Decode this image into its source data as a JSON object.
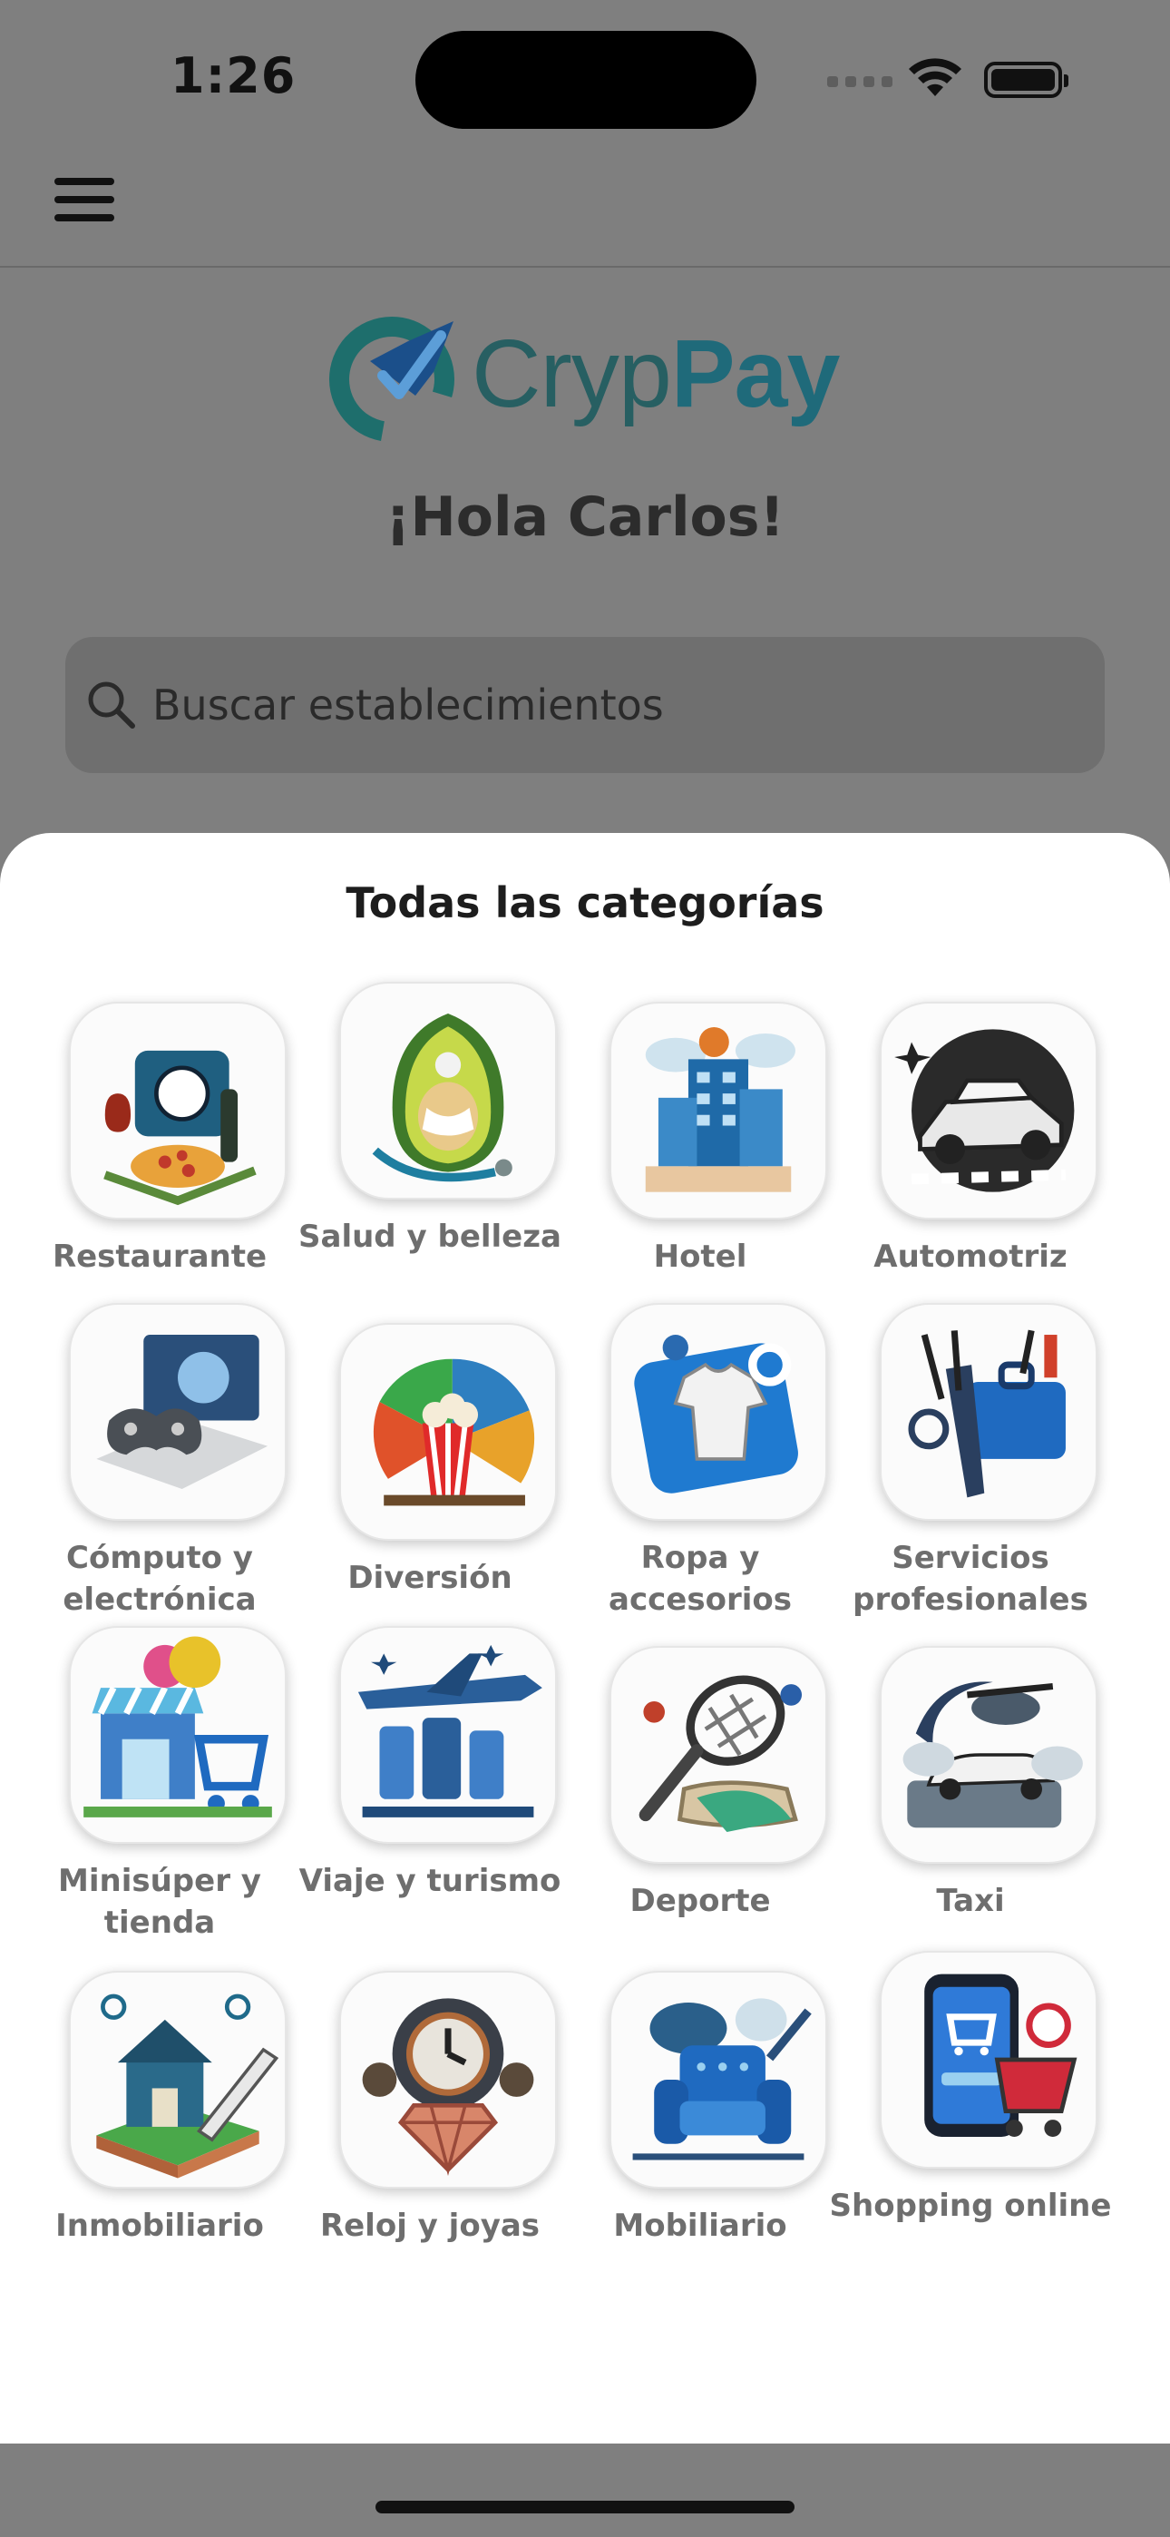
{
  "status_bar": {
    "time": "1:26"
  },
  "header": {
    "menu_icon": "hamburger-menu-icon"
  },
  "logo": {
    "text_light": "Cryp",
    "text_bold": "Pay"
  },
  "greeting": "¡Hola Carlos!",
  "search": {
    "placeholder": "Buscar establecimientos"
  },
  "sheet": {
    "title": "Todas las categorías",
    "categories": [
      {
        "label": "Restaurante",
        "icon": "restaurant-icon"
      },
      {
        "label": "Salud y belleza",
        "icon": "health-beauty-icon"
      },
      {
        "label": "Hotel",
        "icon": "hotel-icon"
      },
      {
        "label": "Automotriz",
        "icon": "car-icon"
      },
      {
        "label": "Cómputo y electrónica",
        "icon": "electronics-icon"
      },
      {
        "label": "Diversión",
        "icon": "entertainment-icon"
      },
      {
        "label": "Ropa y accesorios",
        "icon": "clothing-icon"
      },
      {
        "label": "Servicios profesionales",
        "icon": "briefcase-icon"
      },
      {
        "label": "Minisúper y tienda",
        "icon": "store-icon"
      },
      {
        "label": "Viaje y turismo",
        "icon": "travel-icon"
      },
      {
        "label": "Deporte",
        "icon": "sports-icon"
      },
      {
        "label": "Taxi",
        "icon": "taxi-icon"
      },
      {
        "label": "Inmobiliario",
        "icon": "house-icon"
      },
      {
        "label": "Reloj y joyas",
        "icon": "watch-jewelry-icon"
      },
      {
        "label": "Mobiliario",
        "icon": "armchair-icon"
      },
      {
        "label": "Shopping online",
        "icon": "shopping-cart-icon"
      }
    ]
  },
  "colors": {
    "brand_teal": "#1f6a7a",
    "brand_blue": "#1b5fa8",
    "overlay": "#7f7f7f"
  }
}
